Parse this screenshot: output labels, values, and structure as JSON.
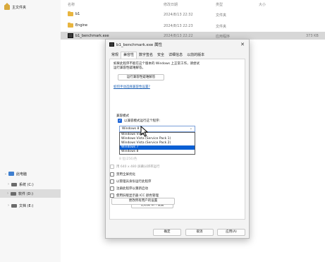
{
  "explorer": {
    "nav": {
      "home": "主文件夹",
      "this_pc": "此电脑",
      "drives": [
        "系统 (C:)",
        "软件 (D:)",
        "文档 (E:)"
      ]
    },
    "columns": {
      "name": "名称",
      "modified": "修改日期",
      "type": "类型",
      "size": "大小"
    },
    "files": [
      {
        "name": "b1",
        "modified": "2024/8/13 22:32",
        "type": "文件夹",
        "size": ""
      },
      {
        "name": "Engine",
        "modified": "2024/8/13 22:23",
        "type": "文件夹",
        "size": ""
      },
      {
        "name": "b1_benchmark.exe",
        "modified": "2024/8/13 22:22",
        "type": "应用程序",
        "size": "373 KB"
      }
    ]
  },
  "dialog": {
    "title": "b1_benchmark.exe 属性",
    "close_label": "✕",
    "tabs": [
      "常规",
      "兼容性",
      "数字签名",
      "安全",
      "详细信息",
      "以前的版本"
    ],
    "active_tab": "兼容性",
    "description": "如果此程序不能在这个版本的 Windows 上正常工作，请尝试运行兼容性疑难解答。",
    "troubleshoot_button": "运行兼容性疑难解答",
    "manual_link": "如何手动选择兼容性设置?",
    "compat_mode": {
      "section": "兼容模式",
      "checkbox_label": "以兼容模式运行这个程序:",
      "checked": true,
      "selected": "Windows 8",
      "options": [
        "Windows Vista",
        "Windows Vista (Service Pack 1)",
        "Windows Vista (Service Pack 2)",
        "Windows 7",
        "Windows 8"
      ],
      "highlighted": "Windows 7"
    },
    "settings": {
      "color_value": "8 位(256)色",
      "items": [
        {
          "label": "用 640 x 480 屏幕分辨率运行",
          "checked": false,
          "disabled": true
        },
        {
          "label": "禁用全屏优化",
          "checked": false,
          "disabled": false
        },
        {
          "label": "以管理员身份运行此程序",
          "checked": false,
          "disabled": false
        },
        {
          "label": "注册此程序以重新启动",
          "checked": false,
          "disabled": false
        },
        {
          "label": "使用旧版显示器 ICC 颜色管理",
          "checked": false,
          "disabled": false
        }
      ],
      "dpi_button": "更改高 DPI 设置"
    },
    "all_users_button": "更改所有用户的设置",
    "footer": {
      "ok": "确定",
      "cancel": "取消",
      "apply": "应用(A)"
    }
  }
}
